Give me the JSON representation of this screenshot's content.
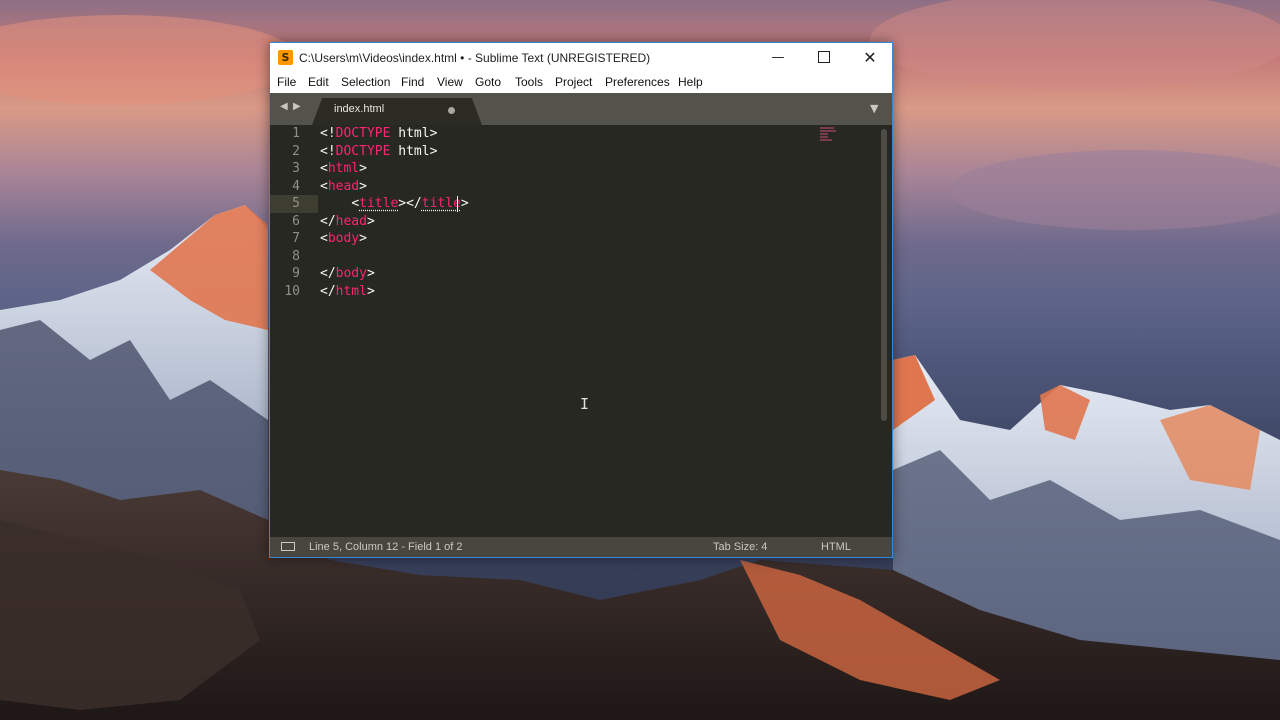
{
  "window": {
    "title": "C:\\Users\\m\\Videos\\index.html • - Sublime Text (UNREGISTERED)",
    "app_icon": "S",
    "controls": {
      "minimize": "—",
      "close": "✕"
    }
  },
  "menu": {
    "items": [
      "File",
      "Edit",
      "Selection",
      "Find",
      "View",
      "Goto",
      "Tools",
      "Project",
      "Preferences",
      "Help"
    ]
  },
  "tabs": {
    "nav_back": "◀",
    "nav_forward": "▶",
    "active_label": "index.html",
    "overflow": "▼"
  },
  "editor": {
    "line_numbers": [
      "1",
      "2",
      "3",
      "4",
      "5",
      "6",
      "7",
      "8",
      "9",
      "10"
    ],
    "current_line": 5,
    "code": {
      "l1_open": "<!",
      "l1_tag": "DOCTYPE",
      "l1_rest": " html>",
      "l2_open": "<!",
      "l2_tag": "DOCTYPE",
      "l2_rest": " html>",
      "l3_open": "<",
      "l3_tag": "html",
      "l3_close": ">",
      "l4_open": "<",
      "l4_tag": "head",
      "l4_close": ">",
      "l5_indent": "    ",
      "l5_open": "<",
      "l5_tag": "title",
      "l5_mid": "></",
      "l5_tag2": "title",
      "l5_close": ">",
      "l6_open": "</",
      "l6_tag": "head",
      "l6_close": ">",
      "l7_open": "<",
      "l7_tag": "body",
      "l7_close": ">",
      "l9_open": "</",
      "l9_tag": "body",
      "l9_close": ">",
      "l10_open": "</",
      "l10_tag": "html",
      "l10_close": ">"
    },
    "text_cursor": "I"
  },
  "status": {
    "position": "Line 5, Column 12 - Field 1 of 2",
    "tab_size": "Tab Size: 4",
    "syntax": "HTML"
  },
  "colors": {
    "editor_bg": "#272822",
    "tag": "#f92672",
    "text": "#f8f8f2",
    "accent_border": "#3a86d6"
  }
}
